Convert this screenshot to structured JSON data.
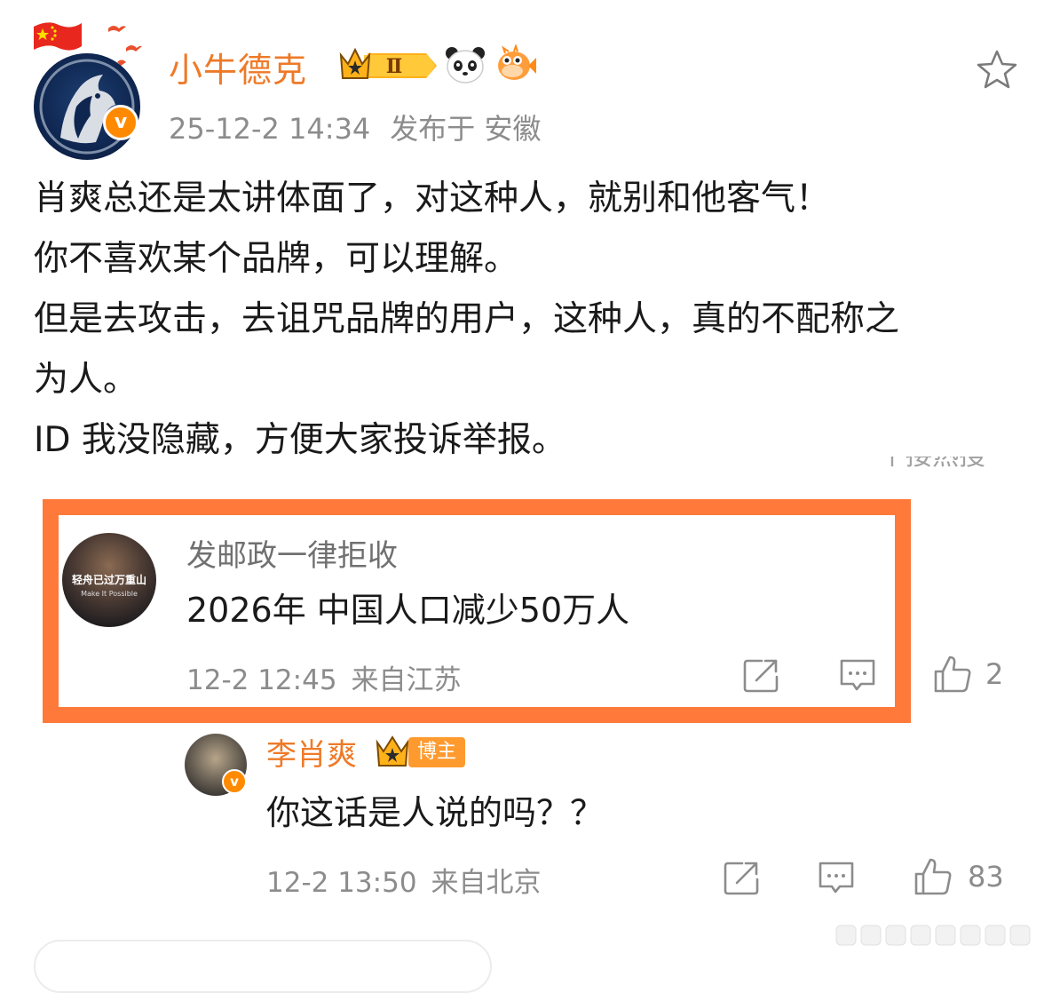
{
  "post": {
    "author": "小牛德克",
    "timestamp": "25-12-2 14:34",
    "location": "发布于 安徽",
    "badge_level": "Ⅱ",
    "verified_mark": "v",
    "lines": [
      "肖爽总还是太讲体面了，对这种人，就别和他客气！",
      "你不喜欢某个品牌，可以理解。",
      "但是去攻击，去诅咒品牌的用户，这种人，真的不配称之",
      "为人。",
      "ID 我没隐藏，方便大家投诉举报。"
    ],
    "cut_off_text": "个接热搜",
    "icons": [
      "china-flag-icon",
      "birds-icon",
      "crown-level-badge-icon",
      "panda-icon",
      "pufferfish-icon",
      "star-favorite-icon"
    ]
  },
  "comment": {
    "author": "发邮政一律拒收",
    "avatar_text_line1": "轻舟已过万重山",
    "avatar_text_line2": "Make It Possible",
    "text": "2026年 中国人口减少50万人",
    "time": "12-2 12:45",
    "location": "来自江苏",
    "likes": "2",
    "highlight_color": "#ff7a3a"
  },
  "reply": {
    "author": "李肖爽",
    "tag": "博主",
    "verified_mark": "v",
    "text": "你这话是人说的吗？？",
    "time": "12-2 13:50",
    "location": "来自北京",
    "likes": "83"
  },
  "colors": {
    "accent_orange": "#ee7a28",
    "meta_gray": "#8c8c8c",
    "verified_orange": "#ff8a00"
  }
}
